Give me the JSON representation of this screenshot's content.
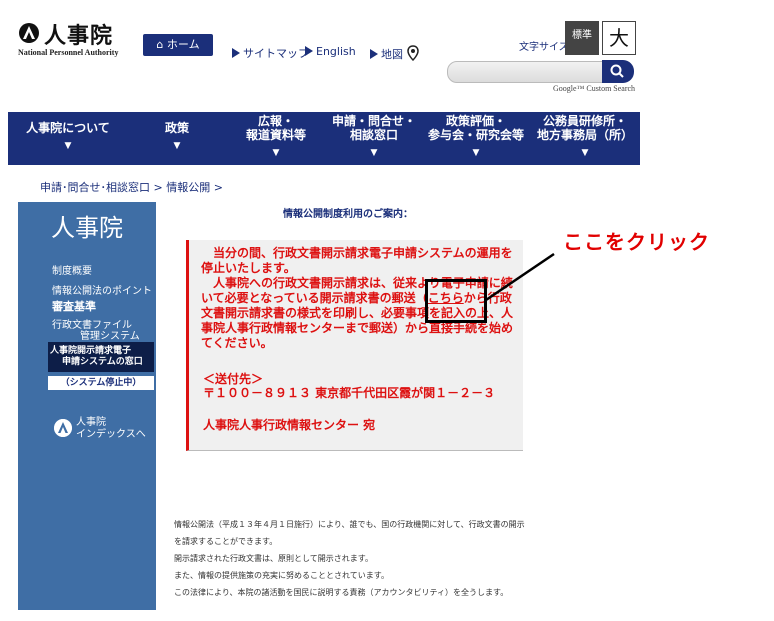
{
  "header": {
    "logo_title": "人事院",
    "logo_sub": "National Personnel Authority",
    "home": "ホーム",
    "links": [
      "サイトマップ",
      "English",
      "地図"
    ],
    "text_size_label": "文字サイズ",
    "text_size_standard": "標準",
    "text_size_large": "大",
    "search_provider": "Google™ Custom Search"
  },
  "nav": {
    "items": [
      {
        "label": "人事院について",
        "arrow": "▼"
      },
      {
        "label": "政策",
        "arrow": "▼"
      },
      {
        "label": "広報・\n報道資料等",
        "arrow": "▼"
      },
      {
        "label": "申請・問合せ・\n相談窓口",
        "arrow": "▼"
      },
      {
        "label": "政策評価・\n参与会・研究会等",
        "arrow": "▼"
      },
      {
        "label": "公務員研修所・\n地方事務局（所）",
        "arrow": "▼"
      }
    ]
  },
  "breadcrumb": "申請･問合せ･相談窓口 > 情報公開 >",
  "sidebar": {
    "title": "人事院",
    "items": [
      "制度概要",
      "情報公開法のポイント",
      "審査基準",
      "行政文書ファイル",
      "管理システム"
    ],
    "active_line1": "人事院開示請求電子",
    "active_line2": "申請システムの窓口",
    "stop_label": "（システム停止中）",
    "index_line1": "人事院",
    "index_line2": "インデックスへ"
  },
  "content": {
    "guide_title": "情報公開制度利用のご案内：",
    "notice_p1": "　当分の間、行政文書開示請求電子申請システムの運用を停止いたします。",
    "notice_p2_a": "　人事院への行政文書開示請求は、従来より電子申請に続いて必要となっている開示請求書の郵送（",
    "notice_link": "こちら",
    "notice_p2_b": "から行政文書開示請求書の様式を印刷し、必要事項を記入の上、人事院人事行政情報センターまで郵送）から直接手続を始めてください。",
    "address_label": "＜送付先＞",
    "address_line": "〒１００－８９１３ 東京都千代田区霞が関１－２－３",
    "address_org": "人事院人事行政情報センター 宛",
    "footer": [
      "情報公開法（平成１３年４月１日施行）により、誰でも、国の行政機関に対して、行政文書の開示",
      "を請求することができます。",
      "開示請求された行政文書は、原則として開示されます。",
      "また、情報の提供施策の充実に努めることとされています。",
      "この法律により、本院の諸活動を国民に説明する責務（アカウンタビリティ）を全うします。"
    ]
  },
  "annotation": {
    "callout": "ここをクリック"
  },
  "colors": {
    "navy": "#1b2f7a",
    "sidebar": "#3f6ea5",
    "notice_red": "#dd1111",
    "callout_red": "#e10000"
  }
}
